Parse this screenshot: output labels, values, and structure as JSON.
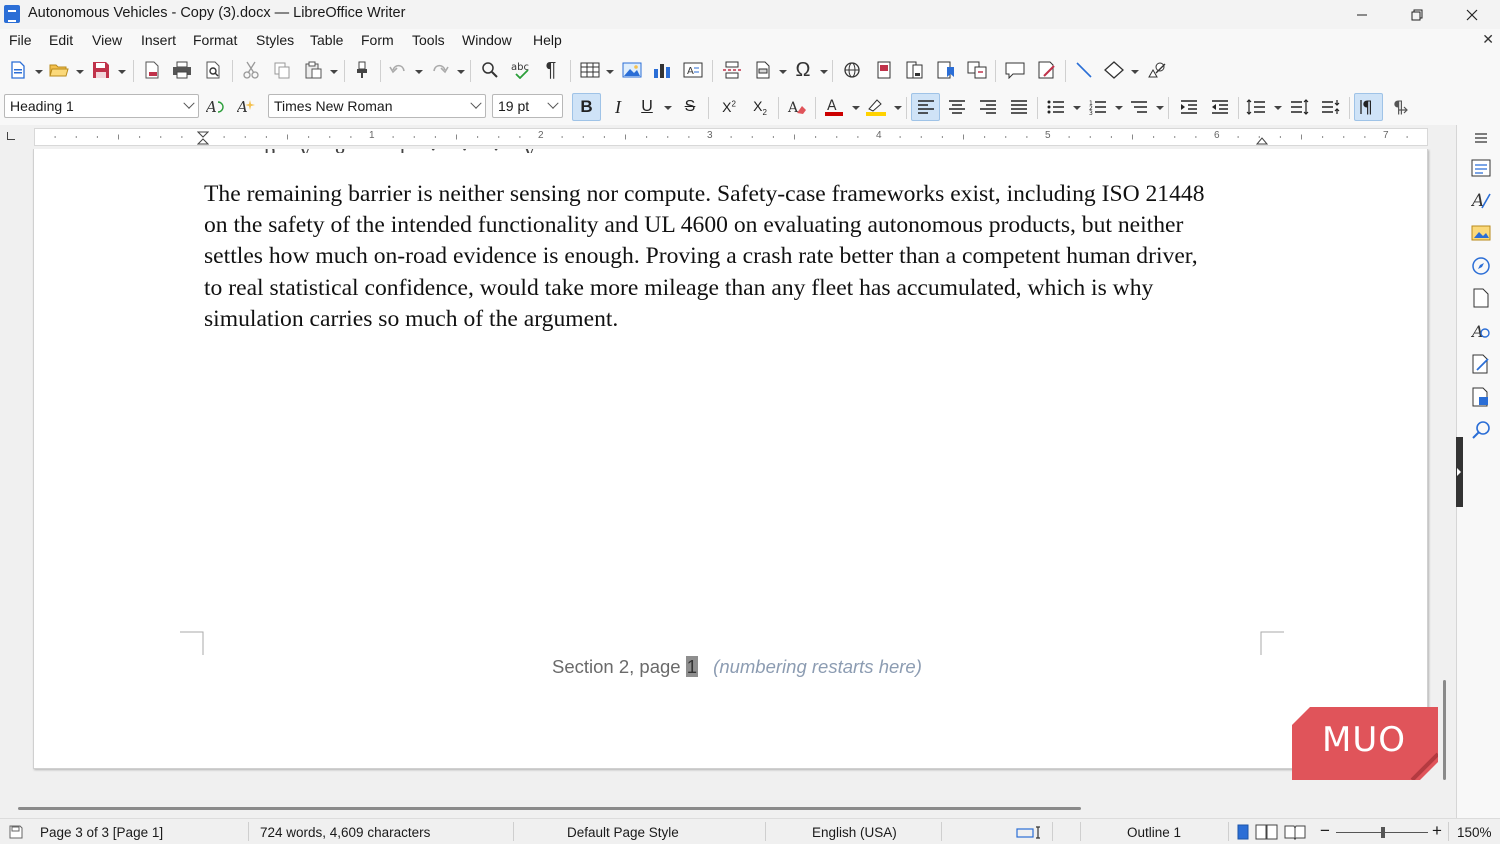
{
  "window": {
    "title": "Autonomous Vehicles - Copy (3).docx — LibreOffice Writer"
  },
  "menu": [
    "File",
    "Edit",
    "View",
    "Insert",
    "Format",
    "Styles",
    "Table",
    "Form",
    "Tools",
    "Window",
    "Help"
  ],
  "format_bar": {
    "paragraph_style": "Heading 1",
    "font_name": "Times New Roman",
    "font_size": "19 pt"
  },
  "ruler": {
    "numbers": [
      "1",
      "2",
      "3",
      "4",
      "5",
      "6",
      "7"
    ]
  },
  "document": {
    "paragraph_lines": [
      "The remaining barrier is neither sensing nor compute. Safety-case frameworks exist, including ISO 21448",
      "on the safety of the intended functionality and UL 4600 on evaluating autonomous products, but neither",
      "settles how much on-road evidence is enough. Proving a crash rate better than a competent human driver,",
      "to real statistical confidence, would take more mileage than any fleet has accumulated, which is why",
      "simulation carries so much of the argument."
    ],
    "footer": {
      "prefix": "Section 2, page",
      "page_number": "1",
      "note": "(numbering restarts here)"
    }
  },
  "watermark": "MUO",
  "status": {
    "page": "Page 3 of 3 [Page 1]",
    "words": "724 words, 4,609 characters",
    "page_style": "Default Page Style",
    "language": "English (USA)",
    "outline": "Outline 1",
    "zoom": "150%"
  },
  "colors": {
    "accent_blue": "#2b6ed6",
    "font_color_red": "#cc0000",
    "highlight_yellow": "#ffd200",
    "watermark_red": "#e0545a"
  }
}
